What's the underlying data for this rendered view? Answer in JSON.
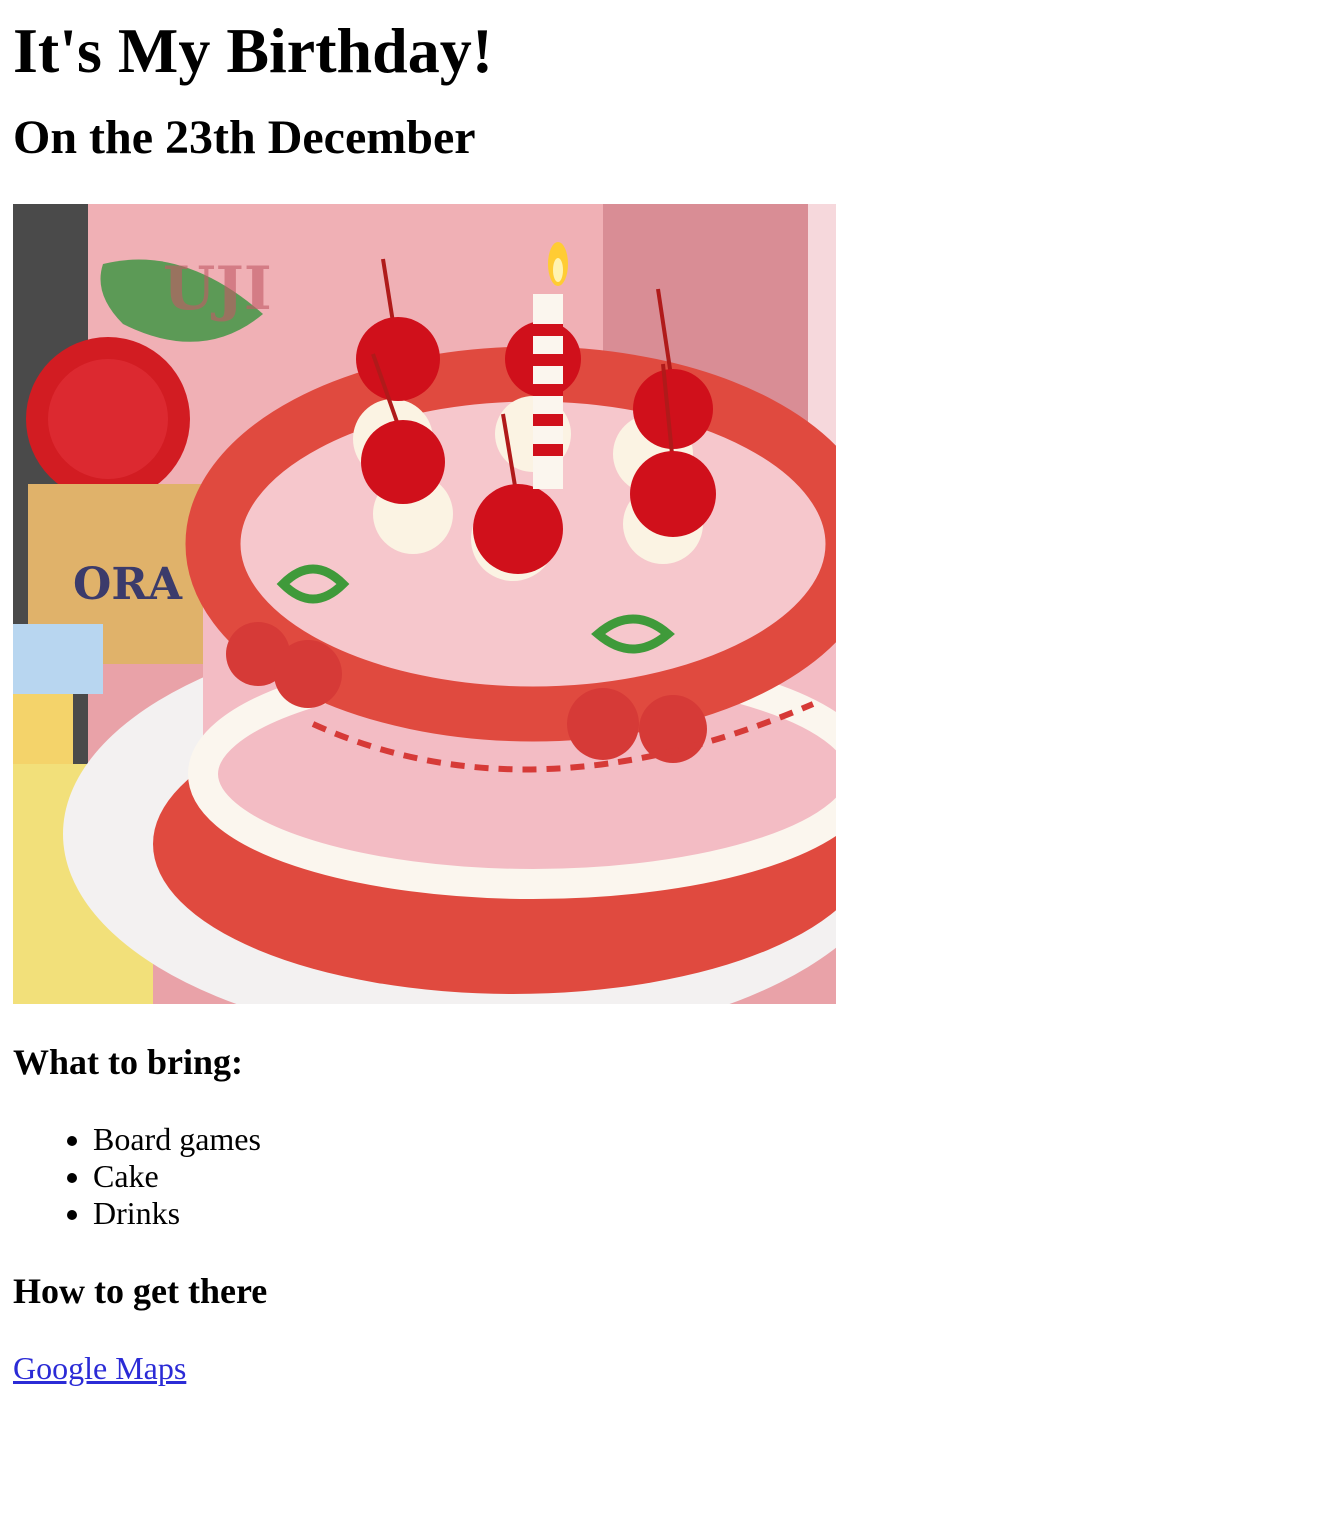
{
  "header": {
    "title": "It's My Birthday!",
    "subtitle": "On the 23th December"
  },
  "bring": {
    "heading": "What to bring:",
    "items": [
      "Board games",
      "Cake",
      "Drinks"
    ]
  },
  "directions": {
    "heading": "How to get there",
    "link_label": "Google Maps"
  },
  "colors": {
    "link": "#2b2bd6",
    "cake_pink": "#f3bcc4",
    "cream_red": "#e04a3f",
    "cherry": "#d0101b",
    "bow_green": "#3f9a3a"
  }
}
